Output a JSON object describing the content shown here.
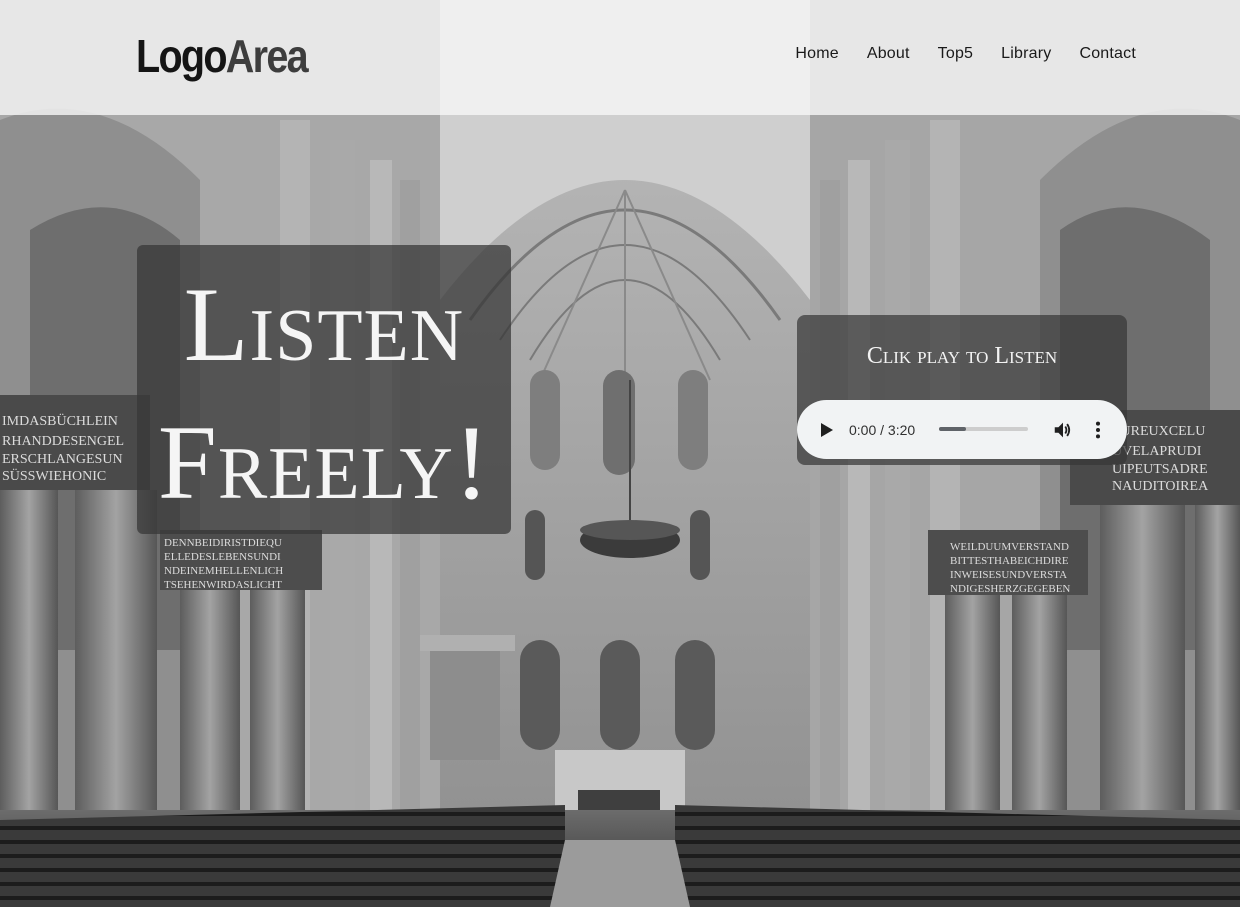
{
  "header": {
    "logo_part1": "Logo",
    "logo_part2": "Area",
    "nav": [
      "Home",
      "About",
      "Top5",
      "Library",
      "Contact"
    ]
  },
  "hero": {
    "line1": "Listen",
    "line2": "Freely!"
  },
  "audio": {
    "title": "Clik play to Listen",
    "time": "0:00 / 3:20",
    "progress_fraction": 0.3,
    "icons": [
      "play-icon",
      "volume-icon",
      "more-vert-icon"
    ]
  },
  "colors": {
    "header_bg": "#f5f5f5",
    "overlay_dark": "#373737",
    "player_bg": "#f1f3f4"
  }
}
